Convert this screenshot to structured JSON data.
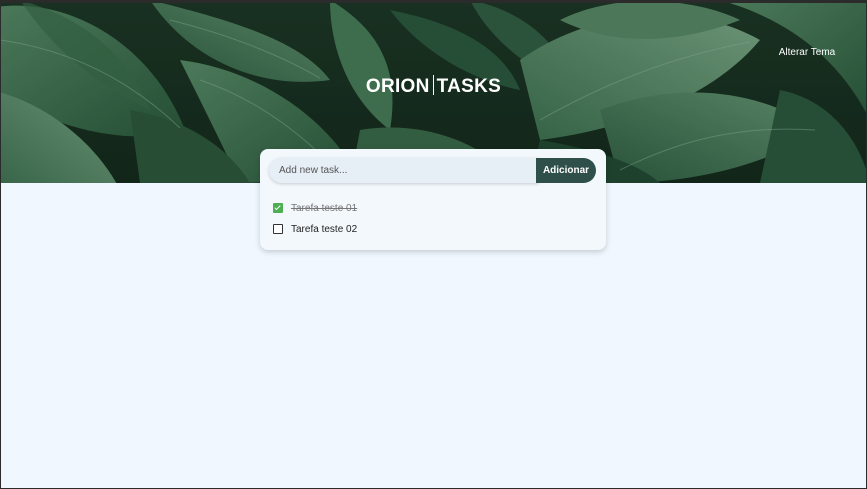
{
  "header": {
    "brand_left": "ORION",
    "brand_right": "TASKS",
    "theme_toggle_label": "Alterar Tema",
    "theme_icon": "moon-icon"
  },
  "new_task": {
    "placeholder": "Add new task...",
    "value": "",
    "add_label": "Adicionar"
  },
  "tasks": [
    {
      "text": "Tarefa teste 01",
      "done": true
    },
    {
      "text": "Tarefa teste 02",
      "done": false
    }
  ],
  "colors": {
    "page_background": "#f0f7ff",
    "button_background": "#2f4f4a",
    "checked_color": "#4caf50"
  }
}
